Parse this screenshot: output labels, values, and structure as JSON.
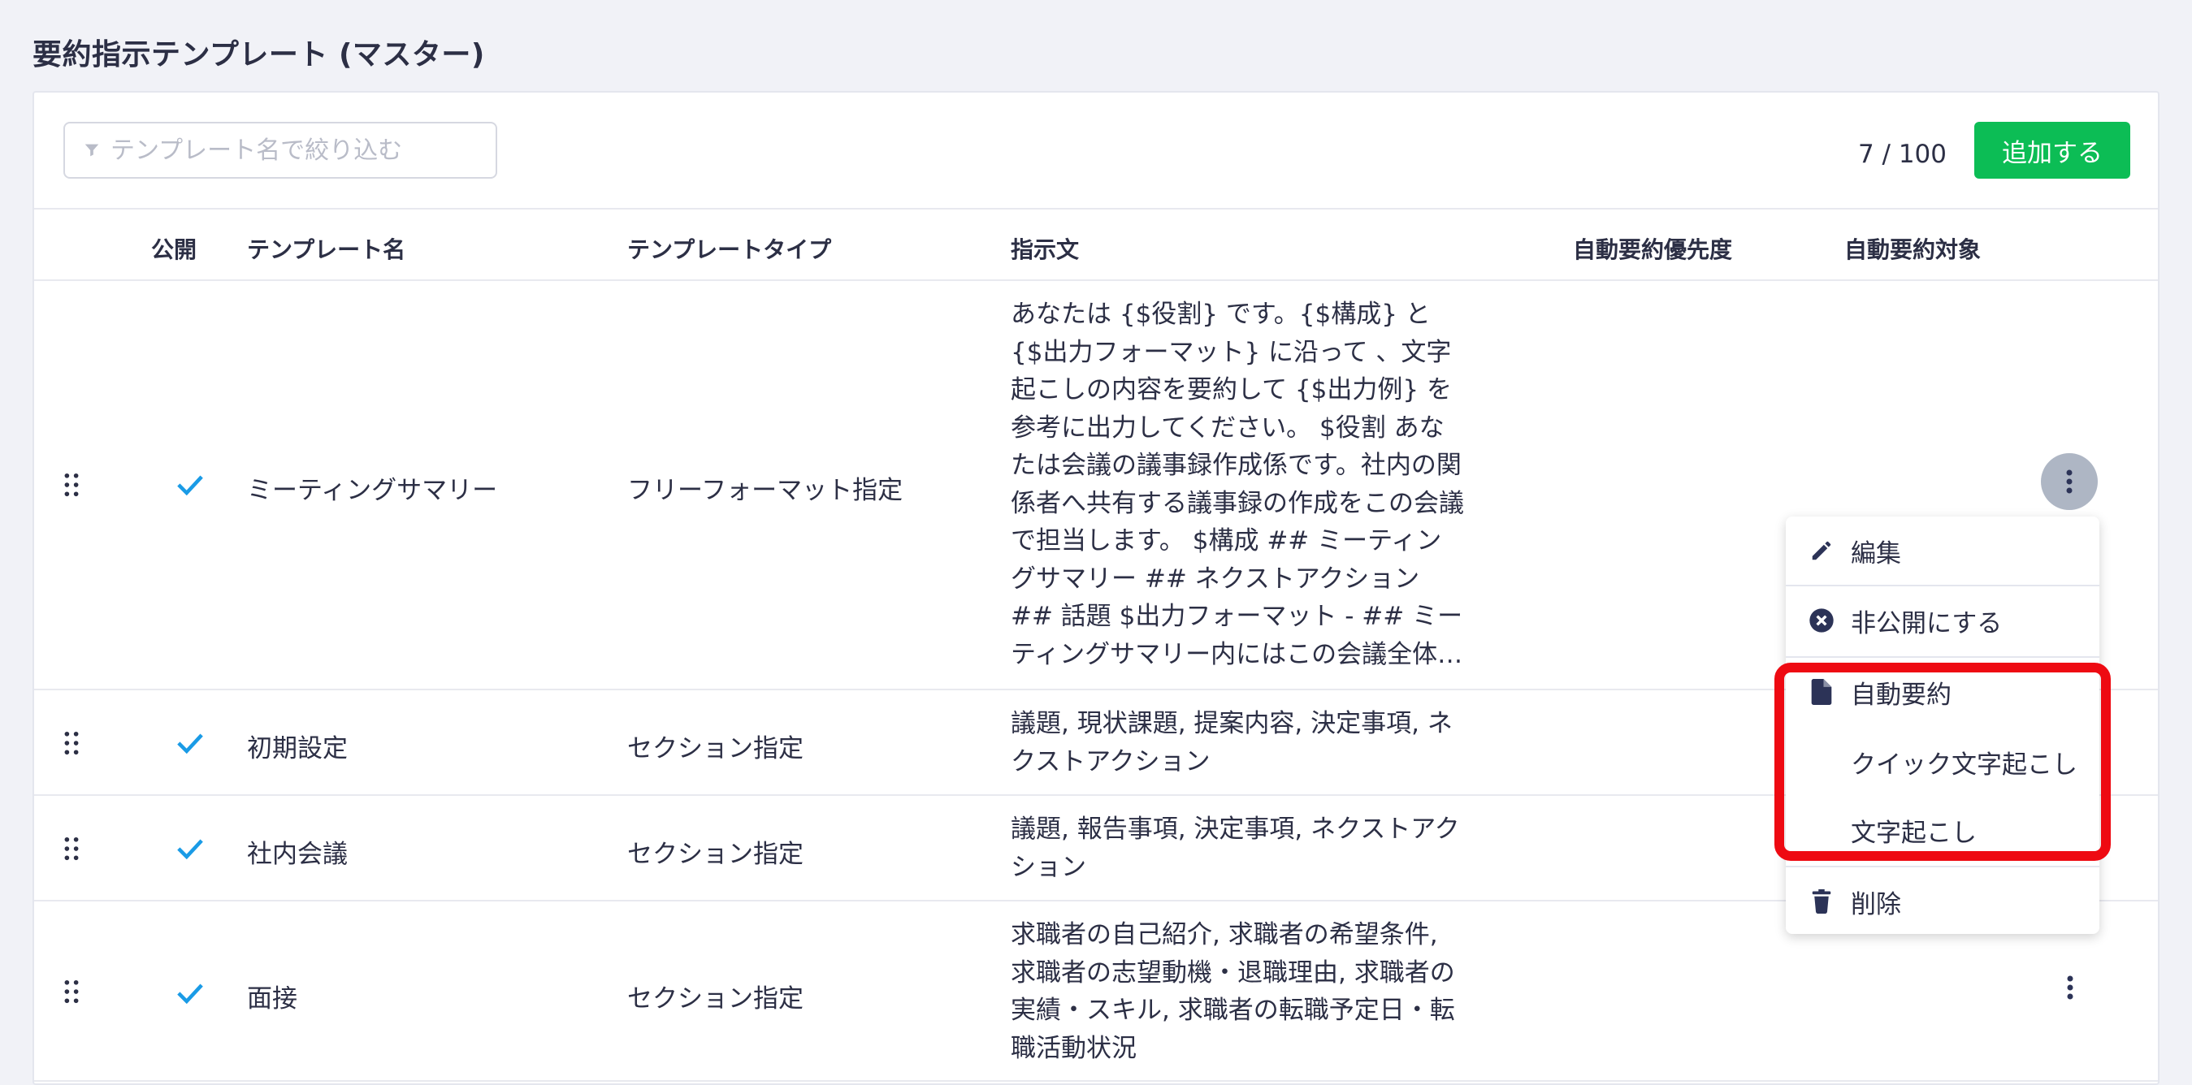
{
  "page_title": "要約指示テンプレート (マスター)",
  "toolbar": {
    "filter_placeholder": "テンプレート名で絞り込む",
    "count": "7 / 100",
    "add_label": "追加する"
  },
  "columns": {
    "public": "公開",
    "name": "テンプレート名",
    "type": "テンプレートタイプ",
    "instruction": "指示文",
    "priority": "自動要約優先度",
    "target": "自動要約対象"
  },
  "rows": [
    {
      "public": true,
      "name": "ミーティングサマリー",
      "type": "フリーフォーマット指定",
      "instruction": "あなたは {$役割} です。{$構成} と {$出力フォーマット} に沿って 、文字起こしの内容を要約して {$出力例} を参考に出力してください。 $役割 あなたは会議の議事録作成係です。社内の関係者へ共有する議事録の作成をこの会議で担当します。 $構成 ## ミーティングサマリー ## ネクストアクション ## 話題 $出力フォーマット - ## ミーティングサマリー内にはこの会議全体のサマリーを記載してください"
    },
    {
      "public": true,
      "name": "初期設定",
      "type": "セクション指定",
      "instruction": "議題, 現状課題, 提案内容, 決定事項, ネクストアクション"
    },
    {
      "public": true,
      "name": "社内会議",
      "type": "セクション指定",
      "instruction": "議題, 報告事項, 決定事項, ネクストアクション"
    },
    {
      "public": true,
      "name": "面接",
      "type": "セクション指定",
      "instruction": "求職者の自己紹介, 求職者の希望条件, 求職者の志望動機・退職理由, 求職者の実績・スキル, 求職者の転職予定日・転職活動状況"
    }
  ],
  "menu": {
    "edit": "編集",
    "unpublish": "非公開にする",
    "auto_summary": "自動要約",
    "quick_transcribe": "クイック文字起こし",
    "transcribe": "文字起こし",
    "delete": "削除"
  },
  "colors": {
    "accent_green": "#0cbd55",
    "check_blue": "#1a9be6",
    "highlight_red": "#ee0a12"
  }
}
